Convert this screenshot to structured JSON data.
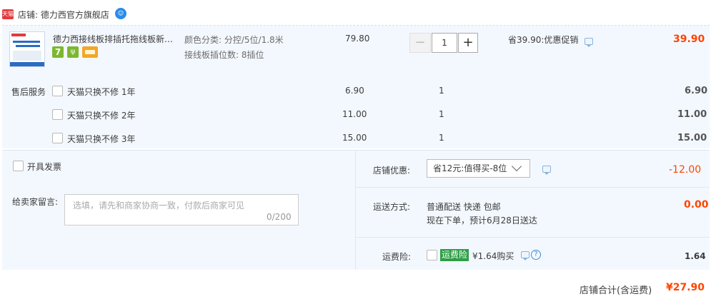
{
  "store": {
    "badge": "天猫",
    "label": "店铺: 德力西官方旗舰店",
    "wangwang_icon": "wangwang-chat-icon"
  },
  "item": {
    "title": "德力西接线板排插托拖线板新国标插座",
    "sku_color": "颜色分类: 分控/5位/1.8米",
    "sku_slots": "接线板插位数: 8插位",
    "unit_price": "79.80",
    "quantity": "1",
    "minus": "−",
    "plus": "+",
    "promo": "省39.90:优惠促销",
    "subtotal": "39.90",
    "badge_seven": "7",
    "badge_g": "ψ"
  },
  "after_sales": {
    "label": "售后服务",
    "options": [
      {
        "name": "天猫只换不修 1年",
        "price": "6.90",
        "qty": "1",
        "sum": "6.90"
      },
      {
        "name": "天猫只换不修 2年",
        "price": "11.00",
        "qty": "1",
        "sum": "11.00"
      },
      {
        "name": "天猫只换不修 3年",
        "price": "15.00",
        "qty": "1",
        "sum": "15.00"
      }
    ]
  },
  "invoice": {
    "label": "开具发票"
  },
  "message": {
    "label": "给卖家留言:",
    "placeholder": "选填，请先和商家协商一致，付款后商家可见",
    "count": "0/200"
  },
  "store_discount": {
    "label": "店铺优惠:",
    "selected": "省12元:值得买-8位",
    "amount": "-12.00"
  },
  "shipping": {
    "label": "运送方式:",
    "method": "普通配送 快递 包邮",
    "eta": "现在下单，预计6月28日送达",
    "fee": "0.00"
  },
  "insurance": {
    "label": "运费险:",
    "badge": "运费险",
    "text": "¥1.64购买",
    "help": "?",
    "fee": "1.64"
  },
  "total": {
    "label": "店铺合计(含运费)",
    "value": "¥27.90"
  },
  "colors": {
    "accent": "#ff4400",
    "panel": "#f3f8fe",
    "insurance": "#2e9e46"
  }
}
